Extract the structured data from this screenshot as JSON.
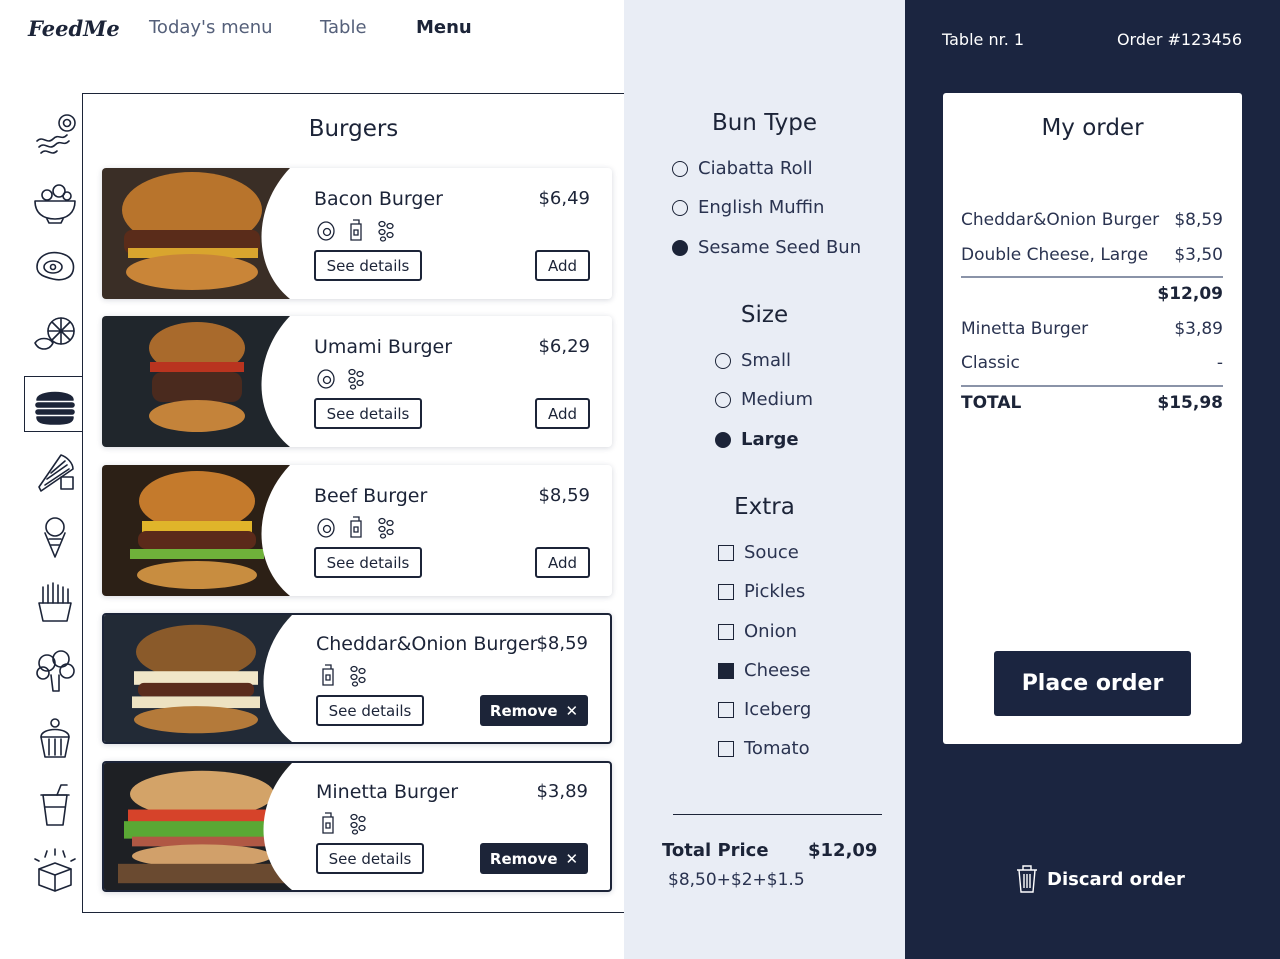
{
  "app": {
    "logo": "FeedMe"
  },
  "nav": {
    "items": [
      {
        "label": "Today's menu"
      },
      {
        "label": "Table"
      },
      {
        "label": "Menu"
      }
    ]
  },
  "categories": [
    {
      "icon": "bacon-egg-icon"
    },
    {
      "icon": "salad-bowl-icon"
    },
    {
      "icon": "steak-icon"
    },
    {
      "icon": "seafood-icon"
    },
    {
      "icon": "burger-icon",
      "active": true
    },
    {
      "icon": "wrap-icon"
    },
    {
      "icon": "ice-cream-icon"
    },
    {
      "icon": "fries-icon"
    },
    {
      "icon": "broccoli-icon"
    },
    {
      "icon": "cupcake-icon"
    },
    {
      "icon": "drink-icon"
    },
    {
      "icon": "gift-box-icon"
    }
  ],
  "menu": {
    "title": "Burgers",
    "details_label": "See details",
    "add_label": "Add",
    "remove_label": "Remove",
    "items": [
      {
        "name": "Bacon Burger",
        "price": "$6,49",
        "selected": false
      },
      {
        "name": "Umami Burger",
        "price": "$6,29",
        "selected": false
      },
      {
        "name": "Beef Burger",
        "price": "$8,59",
        "selected": false
      },
      {
        "name": "Cheddar&Onion Burger",
        "price": "$8,59",
        "selected": true
      },
      {
        "name": "Minetta Burger",
        "price": "$3,89",
        "selected": true
      }
    ]
  },
  "options": {
    "bun_title": "Bun Type",
    "buns": [
      {
        "label": "Ciabatta Roll",
        "selected": false
      },
      {
        "label": "English Muffin",
        "selected": false
      },
      {
        "label": "Sesame Seed Bun",
        "selected": true
      }
    ],
    "size_title": "Size",
    "sizes": [
      {
        "label": "Small",
        "selected": false
      },
      {
        "label": "Medium",
        "selected": false
      },
      {
        "label": "Large",
        "selected": true
      }
    ],
    "extra_title": "Extra",
    "extras": [
      {
        "label": "Souce",
        "checked": false
      },
      {
        "label": "Pickles",
        "checked": false
      },
      {
        "label": "Onion",
        "checked": false
      },
      {
        "label": "Cheese",
        "checked": true
      },
      {
        "label": "Iceberg",
        "checked": false
      },
      {
        "label": "Tomato",
        "checked": false
      }
    ],
    "total_label": "Total Price",
    "total_value": "$12,09",
    "total_formula": "$8,50+$2+$1.5"
  },
  "order": {
    "table": "Table nr. 1",
    "number": "Order #123456",
    "title": "My order",
    "lines": [
      {
        "name": "Cheddar&Onion Burger",
        "price": "$8,59"
      },
      {
        "name": "Double Cheese, Large",
        "price": "$3,50"
      },
      {
        "name": "",
        "price": "$12,09"
      },
      {
        "name": "Minetta Burger",
        "price": "$3,89"
      },
      {
        "name": "Classic",
        "price": "-"
      }
    ],
    "total_label": "TOTAL",
    "total_value": "$15,98",
    "place_label": "Place order",
    "discard_label": "Discard order"
  },
  "colors": {
    "navy": "#1b2540",
    "panel_bg": "#e9edf5",
    "text": "#1c2438"
  }
}
